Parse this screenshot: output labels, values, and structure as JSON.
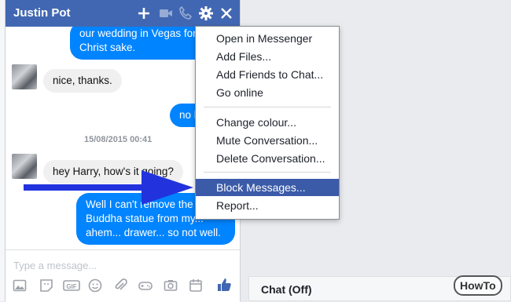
{
  "chat": {
    "title": "Justin Pot",
    "messages": {
      "out1": [
        "our wedding in Vegas for",
        "Christ sake."
      ],
      "in1": "nice, thanks.",
      "out2": "no b",
      "timestamp": "15/08/2015 00:41",
      "in2": "hey Harry, how's it going?",
      "out3": [
        "Well I can't remove the",
        "Buddha statue from my...",
        "ahem... drawer... so not well."
      ]
    },
    "composer_placeholder": "Type a message..."
  },
  "menu": {
    "items": [
      "Open in Messenger",
      "Add Files...",
      "Add Friends to Chat...",
      "Go online",
      "Change colour...",
      "Mute Conversation...",
      "Delete Conversation...",
      "Block Messages...",
      "Report..."
    ],
    "selected": "Block Messages..."
  },
  "sidebar": {
    "chat_status": "Chat (Off)"
  },
  "watermark": "HowTo",
  "colors": {
    "header": "#4267b2",
    "outgoing_bubble": "#0084ff",
    "incoming_bubble": "#f1f0f0",
    "menu_highlight": "#3b5aa8",
    "arrow": "#2233dd"
  }
}
